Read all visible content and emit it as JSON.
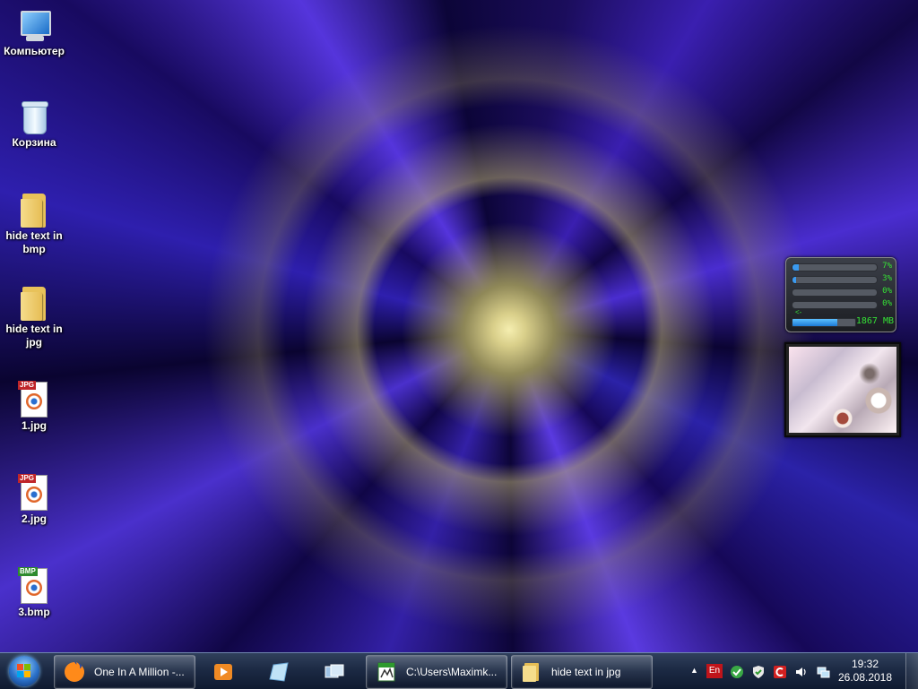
{
  "desktop": {
    "icons": [
      {
        "label": "Компьютер",
        "icon": "computer-icon"
      },
      {
        "label": "Корзина",
        "icon": "recycle-bin-icon"
      },
      {
        "label": "hide text in bmp",
        "icon": "folder-icon"
      },
      {
        "label": "hide text in jpg",
        "icon": "folder-icon"
      },
      {
        "label": "1.jpg",
        "icon": "jpg-file-icon",
        "tag": "JPG"
      },
      {
        "label": "2.jpg",
        "icon": "jpg-file-icon",
        "tag": "JPG"
      },
      {
        "label": "3.bmp",
        "icon": "bmp-file-icon",
        "tag": "BMP"
      }
    ]
  },
  "cpu_gadget": {
    "meters": [
      {
        "value": "7%",
        "level": 0.07
      },
      {
        "value": "3%",
        "level": 0.03
      },
      {
        "value": "0%",
        "level": 0.0
      },
      {
        "value": "0%",
        "level": 0.0
      }
    ],
    "arrows": "<-",
    "memory": {
      "value": "1867 MB",
      "level": 0.72
    }
  },
  "slideshow_gadget": {
    "content": "fractal image"
  },
  "taskbar": {
    "start": "start-orb-icon",
    "buttons": [
      {
        "label": "One In A Million -...",
        "icon": "firefox-icon",
        "pinned": false
      },
      {
        "label": "",
        "icon": "media-player-icon",
        "pinned": true
      },
      {
        "label": "",
        "icon": "app-icon",
        "pinned": true
      },
      {
        "label": "",
        "icon": "window-switch-icon",
        "pinned": true
      },
      {
        "label": "C:\\Users\\Maximk...",
        "icon": "editor-icon",
        "pinned": false
      },
      {
        "label": "hide text in jpg",
        "icon": "folder-icon",
        "pinned": false
      }
    ],
    "tray": {
      "language": "En",
      "time": "19:32",
      "date": "26.08.2018"
    }
  },
  "colors": {
    "taskbar": "#1c2a44",
    "meter_text": "#35e235",
    "meter_fill": "#3a9af0",
    "lang_badge": "#c0141a"
  }
}
